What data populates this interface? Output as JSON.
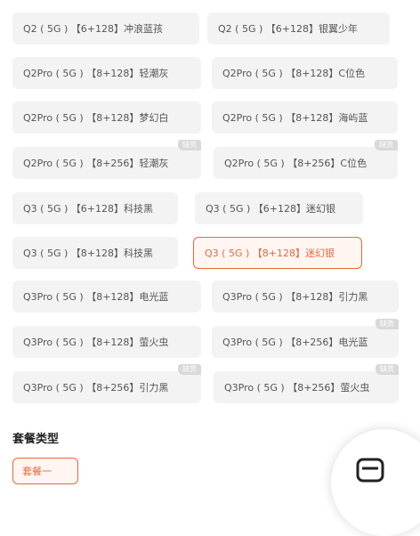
{
  "options": [
    {
      "label": "Q2 ( 5G ) 【6+128】冲浪蓝孩"
    },
    {
      "label": "Q2 ( 5G ) 【6+128】银翼少年"
    },
    {
      "label": "Q2Pro ( 5G ) 【8+128】轻潮灰"
    },
    {
      "label": "Q2Pro ( 5G ) 【8+128】C位色"
    },
    {
      "label": "Q2Pro ( 5G ) 【8+128】梦幻白"
    },
    {
      "label": "Q2Pro ( 5G ) 【8+128】海屿蓝"
    },
    {
      "label": "Q2Pro ( 5G ) 【8+256】轻潮灰",
      "badge": "缺货"
    },
    {
      "label": "Q2Pro ( 5G ) 【8+256】C位色",
      "badge": "缺货"
    },
    {
      "label": "Q3 ( 5G ) 【6+128】科技黑"
    },
    {
      "label": "Q3 ( 5G ) 【6+128】迷幻银"
    },
    {
      "label": "Q3 ( 5G ) 【8+128】科技黑"
    },
    {
      "label": "Q3 ( 5G ) 【8+128】迷幻银",
      "selected": true
    },
    {
      "label": "Q3Pro ( 5G ) 【8+128】电光蓝"
    },
    {
      "label": "Q3Pro ( 5G ) 【8+128】引力黑"
    },
    {
      "label": "Q3Pro ( 5G ) 【8+128】萤火虫"
    },
    {
      "label": "Q3Pro ( 5G ) 【8+256】电光蓝",
      "badge": "缺货"
    },
    {
      "label": "Q3Pro ( 5G ) 【8+256】引力黑",
      "badge": "缺货"
    },
    {
      "label": "Q3Pro ( 5G ) 【8+256】萤火虫",
      "badge": "缺货"
    }
  ],
  "package_section": {
    "title": "套餐类型",
    "first_option": "套餐一"
  },
  "colors": {
    "accent": "#e8683f",
    "chip_bg": "#f3f3f3",
    "badge_bg": "#d9d9d9"
  }
}
